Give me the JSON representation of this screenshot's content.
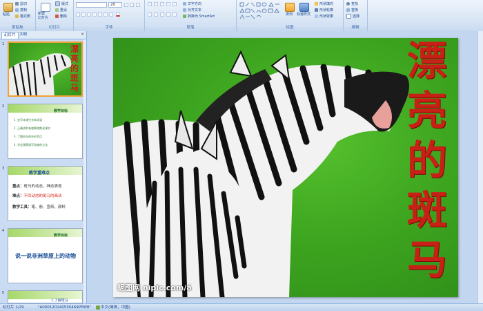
{
  "ribbon": {
    "clipboard": {
      "label": "剪贴板",
      "paste": "粘贴",
      "cut": "剪切",
      "copy": "复制",
      "format_painter": "格式刷"
    },
    "slides": {
      "label": "幻灯片",
      "new_slide": "新建\n幻灯片",
      "layout": "版式",
      "reset": "重设",
      "delete": "删除"
    },
    "font": {
      "label": "字体",
      "font_name": "",
      "font_size": "20"
    },
    "paragraph": {
      "label": "段落",
      "text_direction": "文字方向",
      "align_text": "对齐文本",
      "smartart": "转换为 SmartArt"
    },
    "drawing": {
      "label": "绘图",
      "arrange": "排列",
      "quick_styles": "快速样式",
      "shape_fill": "形状填充",
      "shape_outline": "形状轮廓",
      "shape_effects": "形状效果"
    },
    "editing": {
      "label": "编辑",
      "find": "查找",
      "replace": "替换",
      "select": "选择"
    }
  },
  "left_panel": {
    "tabs": [
      "幻灯片",
      "大纲"
    ],
    "close": "×",
    "thumbnails": [
      {
        "num": "1",
        "title_vertical": [
          "漂",
          "亮",
          "的",
          "斑",
          "马"
        ]
      },
      {
        "num": "2",
        "heading": "教学目标",
        "lines": [
          "1. 会写本课生字和词语",
          "2. 正确流利有感情地朗读课文",
          "3. 了解斑马的外形特点",
          "4. 学会观察描写动物的方法"
        ]
      },
      {
        "num": "3",
        "heading": "教学重难点",
        "points": [
          {
            "label": "重点：",
            "text": "斑马的动态、神态表现"
          },
          {
            "label": "难点：",
            "text": "不同动态的斑马的画法"
          },
          {
            "label": "教学工具：",
            "text": "笔、册、宣纸、颜料"
          }
        ]
      },
      {
        "num": "4",
        "heading": "教学目标",
        "title": "说一说非洲草原上的动物"
      },
      {
        "num": "5",
        "heading": "1.了解斑马"
      }
    ]
  },
  "slide": {
    "title_chars": [
      "漂",
      "亮",
      "的",
      "斑",
      "马"
    ],
    "watermark": "昵图网 nipic.com/á"
  },
  "status": {
    "slide_counter": "幻灯片 1/29",
    "theme": "\"A000120140530469PPW8\"",
    "language": "中文(简体，中国)"
  },
  "colors": {
    "accent": "#f1a237",
    "title_red": "#c81f16",
    "ribbon_blue": "#15428b"
  }
}
